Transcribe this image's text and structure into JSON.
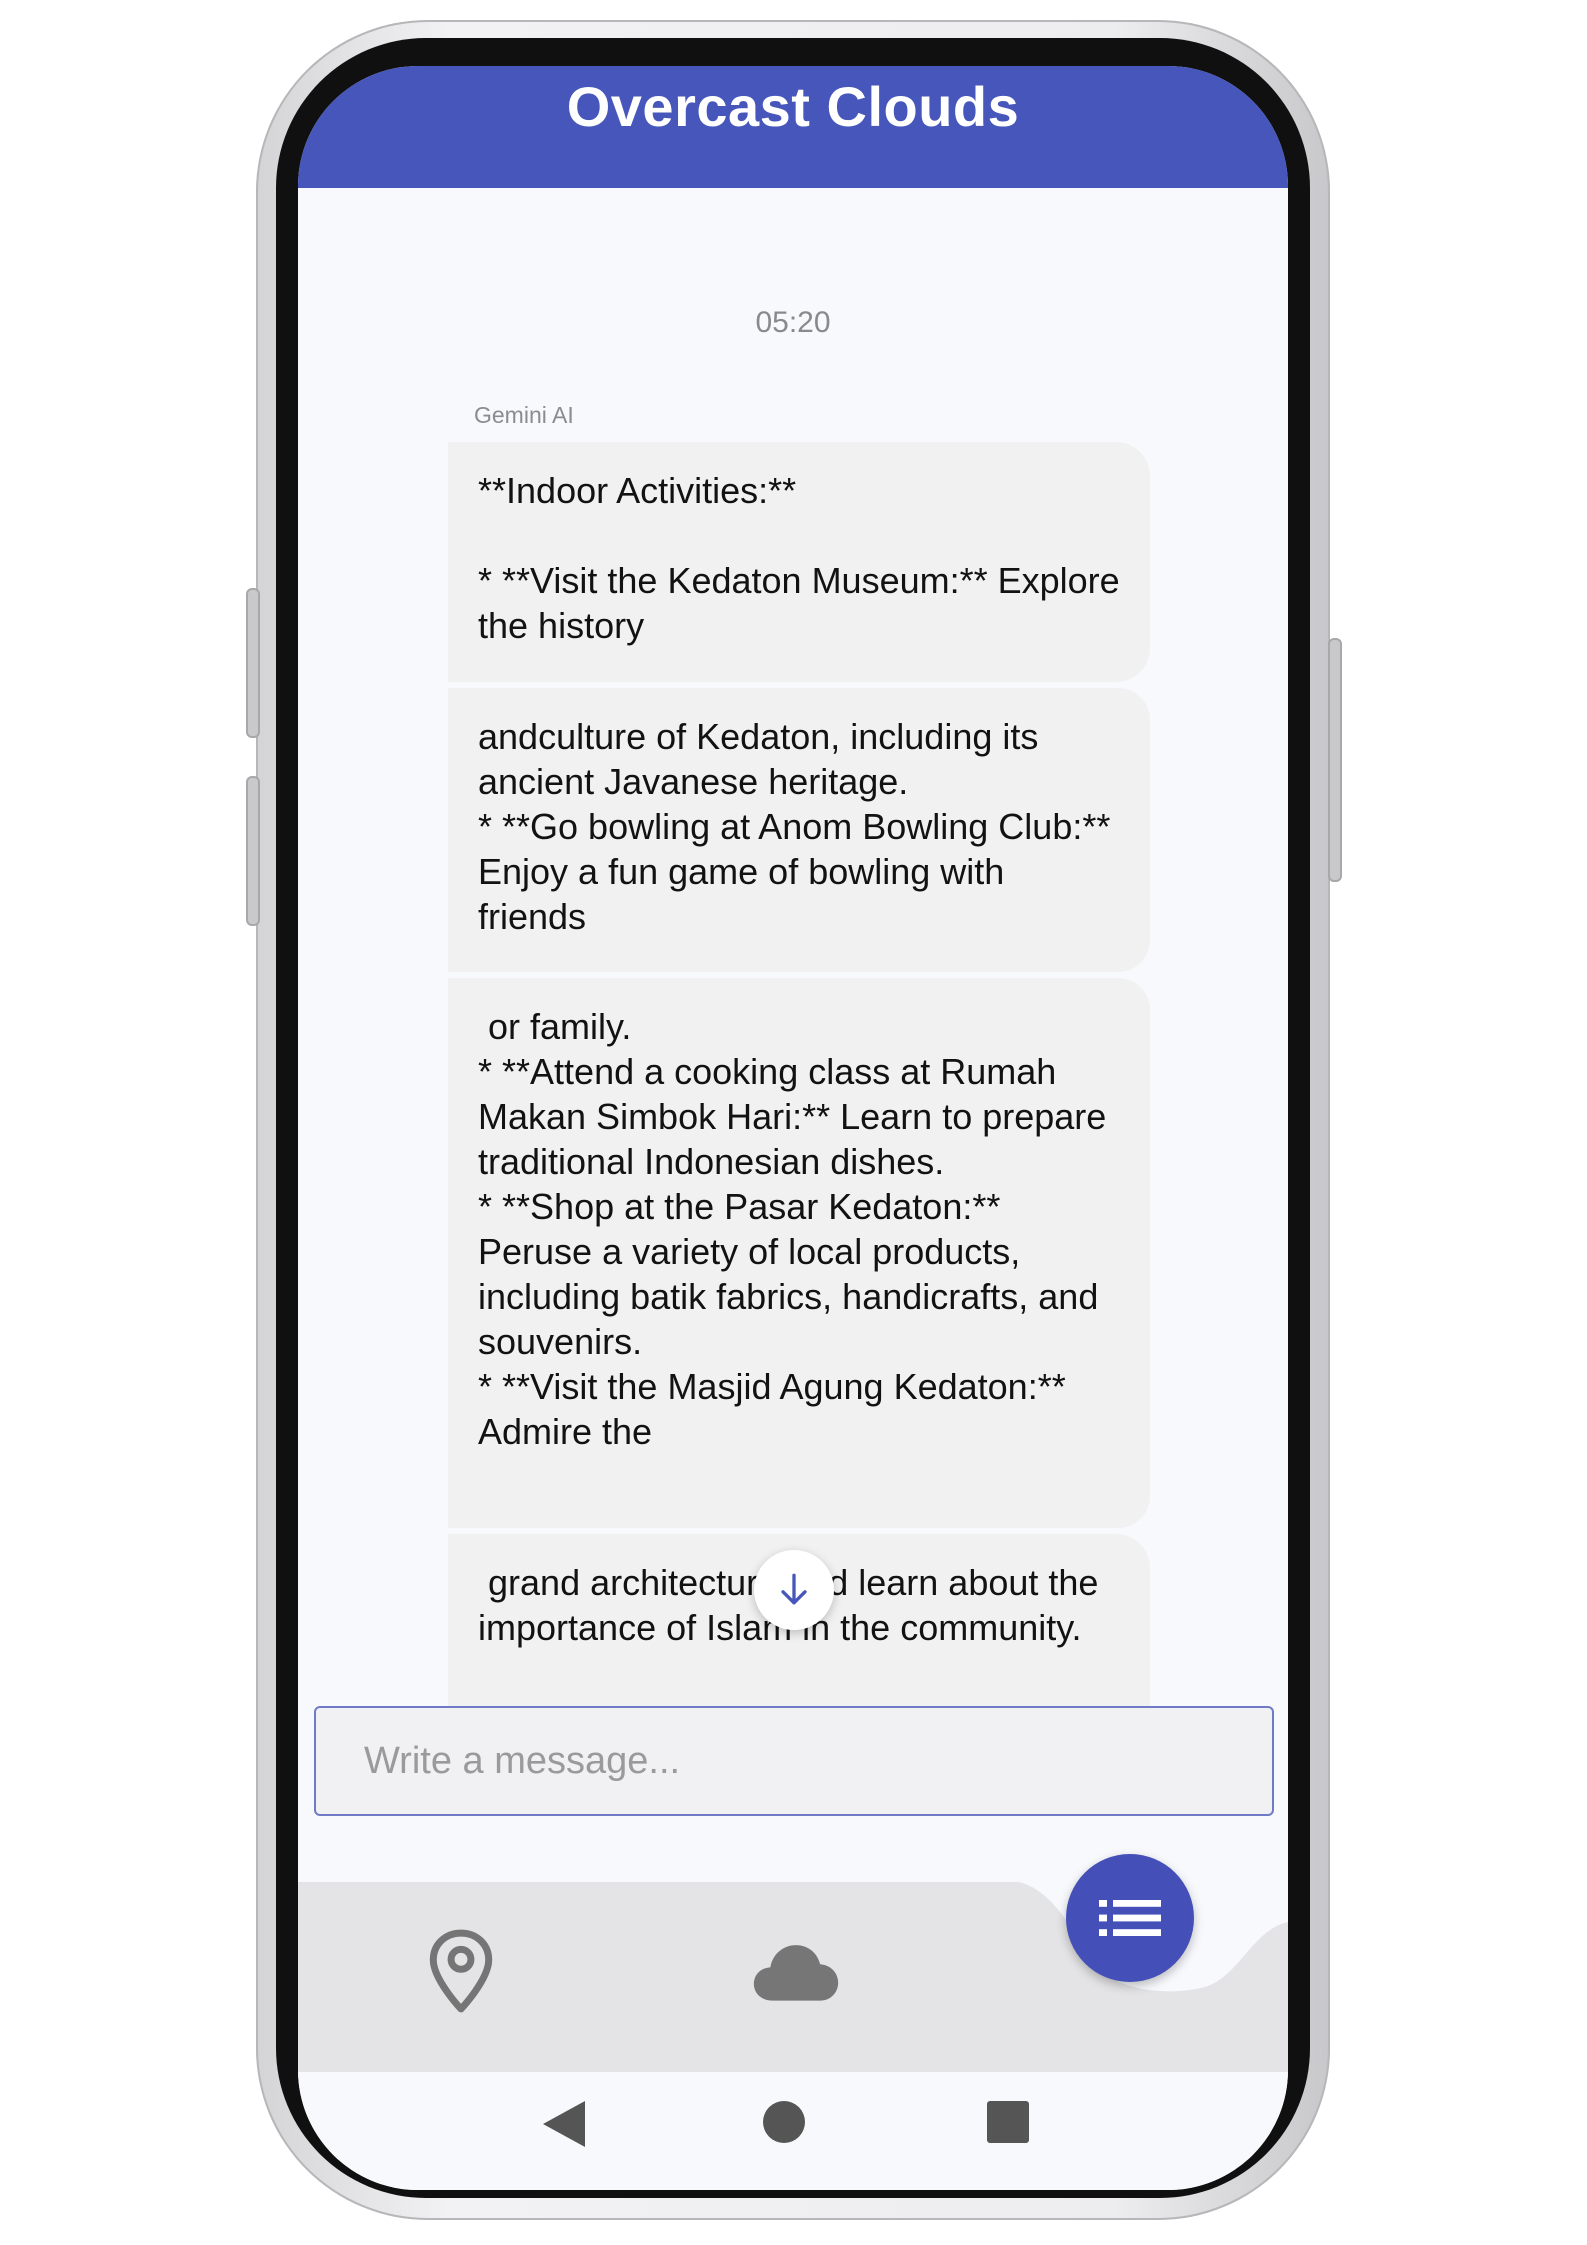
{
  "app_bar": {
    "title": "Overcast Clouds"
  },
  "chat": {
    "timestamp": "05:20",
    "sender": "Gemini AI",
    "messages": [
      "**Indoor Activities:**\n\n* **Visit the Kedaton Museum:** Explore the history",
      "andculture of Kedaton, including its ancient Javanese heritage.\n* **Go bowling at Anom Bowling Club:** Enjoy a fun game of bowling with friends",
      " or family.\n* **Attend a cooking class at Rumah Makan Simbok Hari:** Learn to prepare traditional Indonesian dishes.\n* **Shop at the Pasar Kedaton:** Peruse a variety of local products, including batik fabrics, handicrafts, and souvenirs.\n* **Visit the Masjid Agung Kedaton:** Admire the",
      " grand architecture and learn about the importance of Islam in the community."
    ]
  },
  "input": {
    "placeholder": "Write a message..."
  },
  "bottom_nav": {
    "items": [
      {
        "icon": "location-pin-icon"
      },
      {
        "icon": "cloud-icon"
      }
    ],
    "fab_icon": "list-icon"
  },
  "system_nav": {
    "icons": [
      "back-triangle-icon",
      "home-circle-icon",
      "recents-square-icon"
    ]
  },
  "colors": {
    "primary": "#4656ba",
    "fab": "#4450b8",
    "bubble": "#f1f1f2",
    "nav_background": "#e4e4e6",
    "screen_background": "#f8f9fc"
  }
}
